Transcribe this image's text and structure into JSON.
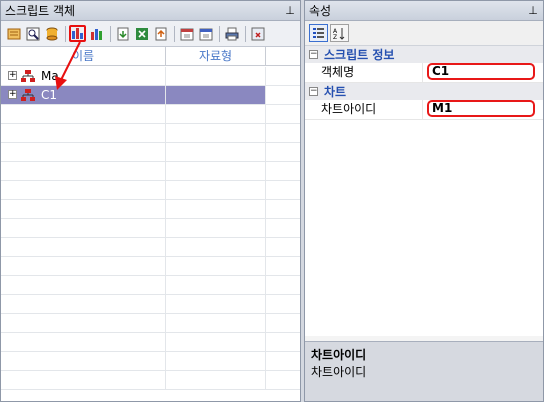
{
  "left_panel": {
    "title": "스크립트 객체",
    "pin": "ᵽ",
    "toolbar_icons": [
      "script-icon",
      "find-icon",
      "database-icon",
      "chart-add-icon",
      "chart-component-icon",
      "import-icon",
      "excel-icon",
      "export-icon",
      "calendar-icon",
      "calendar-edit-icon",
      "print-icon",
      "settings-close-icon"
    ],
    "columns": [
      "이름",
      "자료형"
    ],
    "tree": [
      {
        "label": "Ma",
        "icon": "hierarchy-icon",
        "expanded": false,
        "selected": false
      },
      {
        "label": "C1",
        "icon": "hierarchy-icon",
        "expanded": false,
        "selected": true
      }
    ]
  },
  "right_panel": {
    "title": "속성",
    "pin": "ᵽ",
    "toolbar_icons": [
      "categorized-icon",
      "alphabetical-icon"
    ],
    "categories": [
      {
        "name": "스크립트 정보",
        "properties": [
          {
            "name": "객체명",
            "value": "C1"
          }
        ]
      },
      {
        "name": "차트",
        "properties": [
          {
            "name": "차트아이디",
            "value": "M1"
          }
        ]
      }
    ],
    "description": {
      "title": "차트아이디",
      "text": "차트아이디"
    }
  },
  "colors": {
    "selection": "#8a88c0",
    "highlight": "#e81010",
    "header_text": "#4a78c8",
    "category_text": "#2550b0"
  }
}
